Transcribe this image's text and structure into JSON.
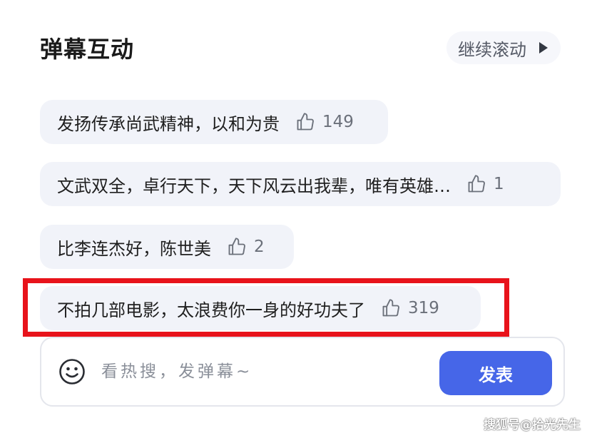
{
  "header": {
    "title": "弹幕互动",
    "continue_label": "继续滚动"
  },
  "comments": [
    {
      "text": "发扬传承尚武精神，以和为贵",
      "likes": "149"
    },
    {
      "text": "文武双全，卓行天下，天下风云出我辈，唯有英雄…",
      "likes": "1"
    },
    {
      "text": "比李连杰好，陈世美",
      "likes": "2"
    },
    {
      "text": "不拍几部电影，太浪费你一身的好功夫了",
      "likes": "319",
      "highlighted": true
    }
  ],
  "composer": {
    "placeholder": "看热搜，发弹幕~",
    "send_label": "发表"
  },
  "watermark": "搜狐号@拾光先生",
  "colors": {
    "accent": "#4666e8",
    "highlight_border": "#e8131b",
    "bubble_bg": "#f1f3f9"
  }
}
